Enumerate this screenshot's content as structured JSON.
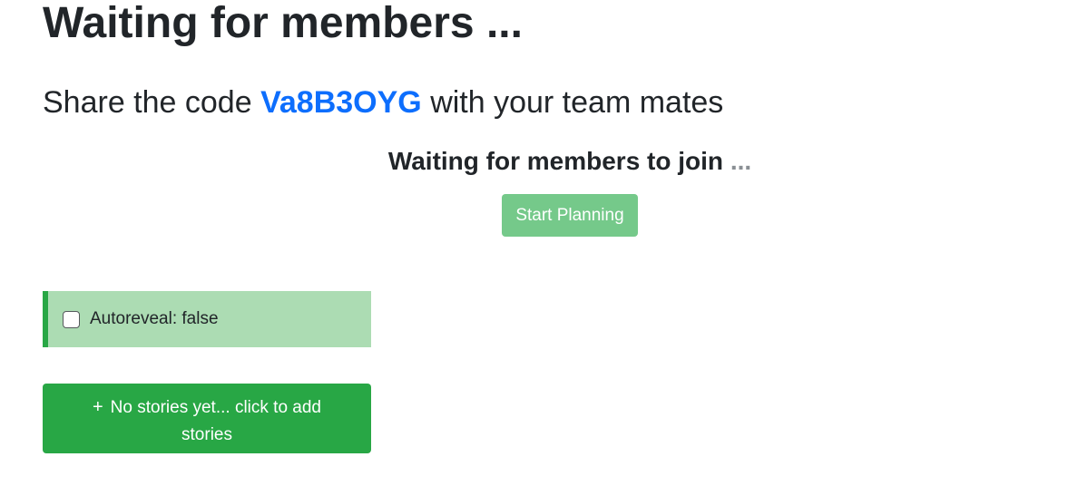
{
  "header": {
    "title": "Waiting for members ...",
    "share_prefix": "Share the code",
    "code": "Va8B3OYG",
    "share_suffix": "with your team mates"
  },
  "waiting": {
    "text": "Waiting for members to join",
    "dots": "..."
  },
  "start_button": {
    "label": "Start Planning",
    "color": "#75c98a"
  },
  "autoreveal": {
    "label": "Autoreveal: false",
    "checked": false,
    "background": "#acdcb3",
    "accent": "#28a745"
  },
  "stories": {
    "icon": "plus-icon",
    "icon_glyph": "+",
    "label": "No stories yet... click to add stories",
    "color": "#28a745"
  },
  "colors": {
    "code": "#0d6efd",
    "text": "#212529"
  }
}
